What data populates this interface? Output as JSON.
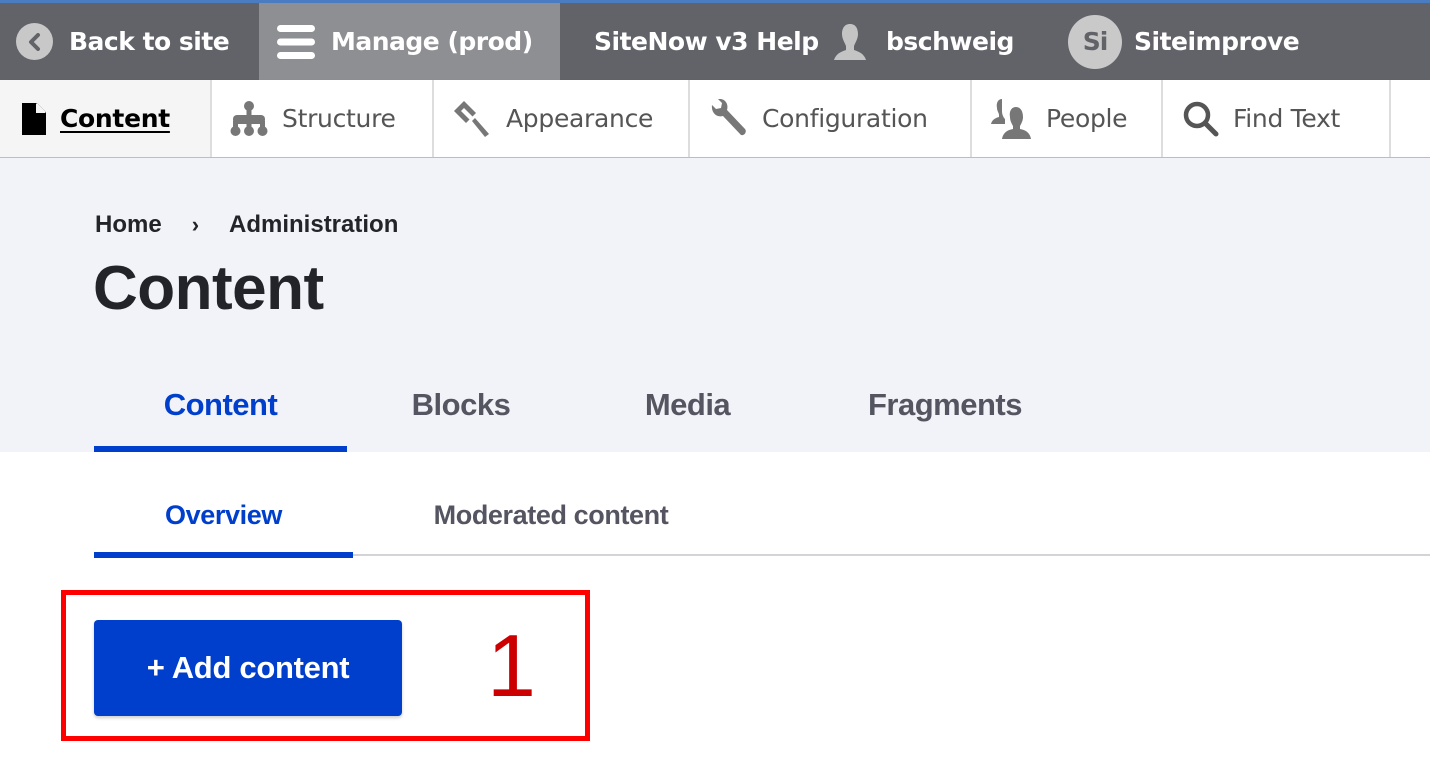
{
  "toolbar": {
    "back_to_site": "Back to site",
    "manage": "Manage (prod)",
    "help": "SiteNow v3 Help",
    "user": "bschweig",
    "siteimprove_badge": "Si",
    "siteimprove": "Siteimprove",
    "accent_color": "#4a7cc2"
  },
  "tray": {
    "items": [
      {
        "label": "Content",
        "icon": "document-icon",
        "active": true
      },
      {
        "label": "Structure",
        "icon": "hierarchy-icon"
      },
      {
        "label": "Appearance",
        "icon": "paintbrush-icon"
      },
      {
        "label": "Configuration",
        "icon": "wrench-icon"
      },
      {
        "label": "People",
        "icon": "people-icon"
      },
      {
        "label": "Find Text",
        "icon": "search-icon"
      }
    ]
  },
  "breadcrumb": {
    "items": [
      "Home",
      "Administration"
    ],
    "separator": "›"
  },
  "page": {
    "title": "Content"
  },
  "primary_tabs": [
    {
      "label": "Content",
      "active": true
    },
    {
      "label": "Blocks"
    },
    {
      "label": "Media"
    },
    {
      "label": "Fragments"
    }
  ],
  "secondary_tabs": [
    {
      "label": "Overview",
      "active": true
    },
    {
      "label": "Moderated content"
    }
  ],
  "actions": {
    "add_content": "+ Add content"
  },
  "annotation": {
    "number": "1",
    "color": "#ff0000"
  },
  "colors": {
    "brand_blue": "#003ecc",
    "toolbar_gray": "#616368"
  }
}
